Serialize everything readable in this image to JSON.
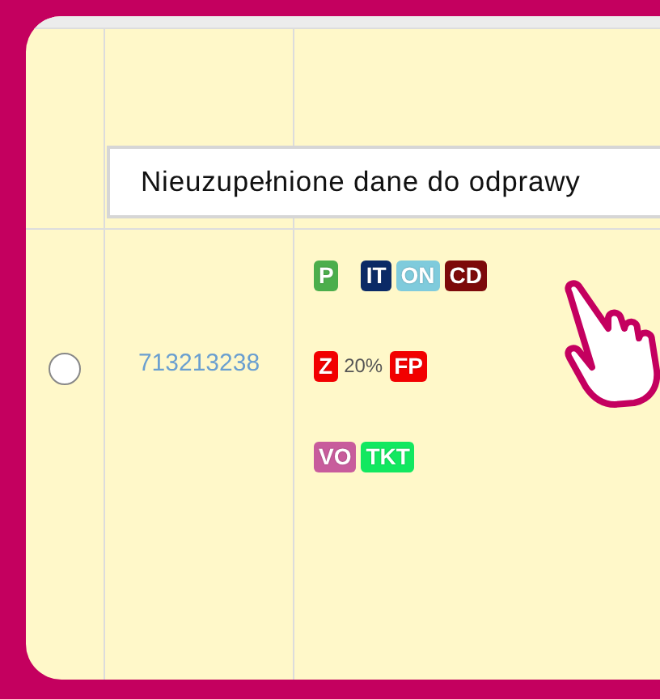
{
  "tooltip": {
    "text": "Nieuzupełnione dane do odprawy"
  },
  "rows": [
    {
      "selected": false,
      "number": "713213238",
      "badge_lines": [
        [
          [
            {
              "kind": "badge",
              "text": "P",
              "color": "#4cae4c"
            }
          ],
          [
            {
              "kind": "badge",
              "text": "IT",
              "color": "#0b2a66"
            },
            {
              "kind": "badge",
              "text": "ON",
              "color": "#7fcbdc"
            },
            {
              "kind": "badge",
              "text": "CD",
              "color": "#7d0a0a"
            }
          ]
        ],
        [
          [
            {
              "kind": "badge",
              "text": "Z",
              "color": "#f20000"
            },
            {
              "kind": "text",
              "text": "20%"
            },
            {
              "kind": "badge",
              "text": "FP",
              "color": "#f20000"
            }
          ]
        ],
        [
          [
            {
              "kind": "badge",
              "text": "VO",
              "color": "#c85c9c"
            },
            {
              "kind": "badge",
              "text": "TKT",
              "color": "#12e860"
            }
          ]
        ]
      ]
    }
  ]
}
